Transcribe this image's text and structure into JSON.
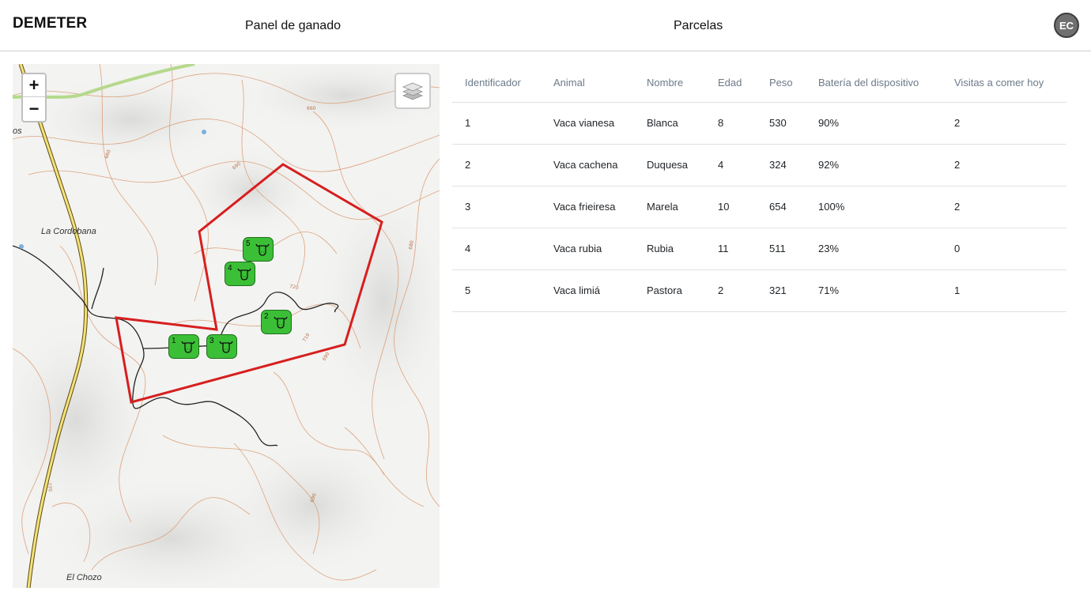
{
  "header": {
    "brand": "DEMETER",
    "nav": [
      {
        "label": "Panel de ganado"
      },
      {
        "label": "Parcelas"
      }
    ],
    "avatar_initials": "EC"
  },
  "map": {
    "controls": {
      "zoom_in": "+",
      "zoom_out": "−",
      "layers_icon": "layers-icon"
    },
    "places": [
      "La Cordobana",
      "El Chozo",
      "os"
    ],
    "contour_labels": [
      "660",
      "690",
      "720",
      "710",
      "690",
      "680",
      "660",
      "770",
      "690"
    ],
    "markers": [
      {
        "id": "1",
        "icon": "cow-icon"
      },
      {
        "id": "2",
        "icon": "cow-icon"
      },
      {
        "id": "3",
        "icon": "cow-icon"
      },
      {
        "id": "4",
        "icon": "cow-icon"
      },
      {
        "id": "5",
        "icon": "cow-icon"
      }
    ],
    "colors": {
      "parcel_border": "#d61f1f",
      "marker_fill": "#3bbf36",
      "contour": "#d9956a"
    }
  },
  "table": {
    "headers": [
      "Identificador",
      "Animal",
      "Nombre",
      "Edad",
      "Peso",
      "Batería del dispositivo",
      "Visitas a comer hoy"
    ],
    "rows": [
      [
        "1",
        "Vaca vianesa",
        "Blanca",
        "8",
        "530",
        "90%",
        "2"
      ],
      [
        "2",
        "Vaca cachena",
        "Duquesa",
        "4",
        "324",
        "92%",
        "2"
      ],
      [
        "3",
        "Vaca frieiresa",
        "Marela",
        "10",
        "654",
        "100%",
        "2"
      ],
      [
        "4",
        "Vaca rubia",
        "Rubia",
        "11",
        "511",
        "23%",
        "0"
      ],
      [
        "5",
        "Vaca limiá",
        "Pastora",
        "2",
        "321",
        "71%",
        "1"
      ]
    ]
  }
}
